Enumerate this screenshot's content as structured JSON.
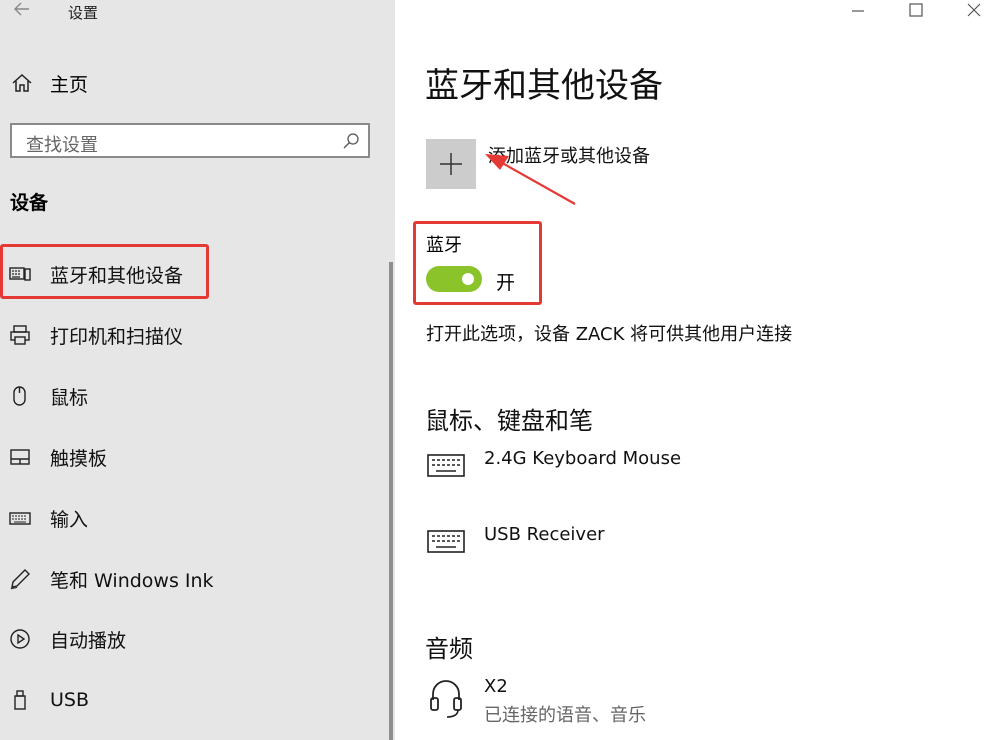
{
  "window": {
    "title": "设置"
  },
  "sidebar": {
    "home_label": "主页",
    "search_placeholder": "查找设置",
    "section_title": "设备",
    "items": [
      {
        "label": "蓝牙和其他设备",
        "icon": "bluetooth-devices-icon",
        "selected": true
      },
      {
        "label": "打印机和扫描仪",
        "icon": "printer-icon"
      },
      {
        "label": "鼠标",
        "icon": "mouse-icon"
      },
      {
        "label": "触摸板",
        "icon": "touchpad-icon"
      },
      {
        "label": "输入",
        "icon": "keyboard-icon"
      },
      {
        "label": "笔和 Windows Ink",
        "icon": "pen-icon"
      },
      {
        "label": "自动播放",
        "icon": "autoplay-icon"
      },
      {
        "label": "USB",
        "icon": "usb-icon"
      }
    ]
  },
  "main": {
    "page_title": "蓝牙和其他设备",
    "add_device_label": "添加蓝牙或其他设备",
    "bluetooth": {
      "label": "蓝牙",
      "state": "开",
      "on": true,
      "description": "打开此选项，设备 ZACK 将可供其他用户连接"
    },
    "sections": [
      {
        "title": "鼠标、键盘和笔",
        "devices": [
          {
            "name": "2.4G Keyboard Mouse",
            "icon": "keyboard-icon"
          },
          {
            "name": "USB Receiver",
            "icon": "keyboard-icon"
          }
        ]
      },
      {
        "title": "音频",
        "devices": [
          {
            "name": "X2",
            "status": "已连接的语音、音乐",
            "icon": "headset-icon"
          }
        ]
      }
    ]
  },
  "colors": {
    "accent_green": "#8ac42a",
    "highlight_red": "#e53935",
    "sidebar_bg": "#e6e6e6"
  }
}
